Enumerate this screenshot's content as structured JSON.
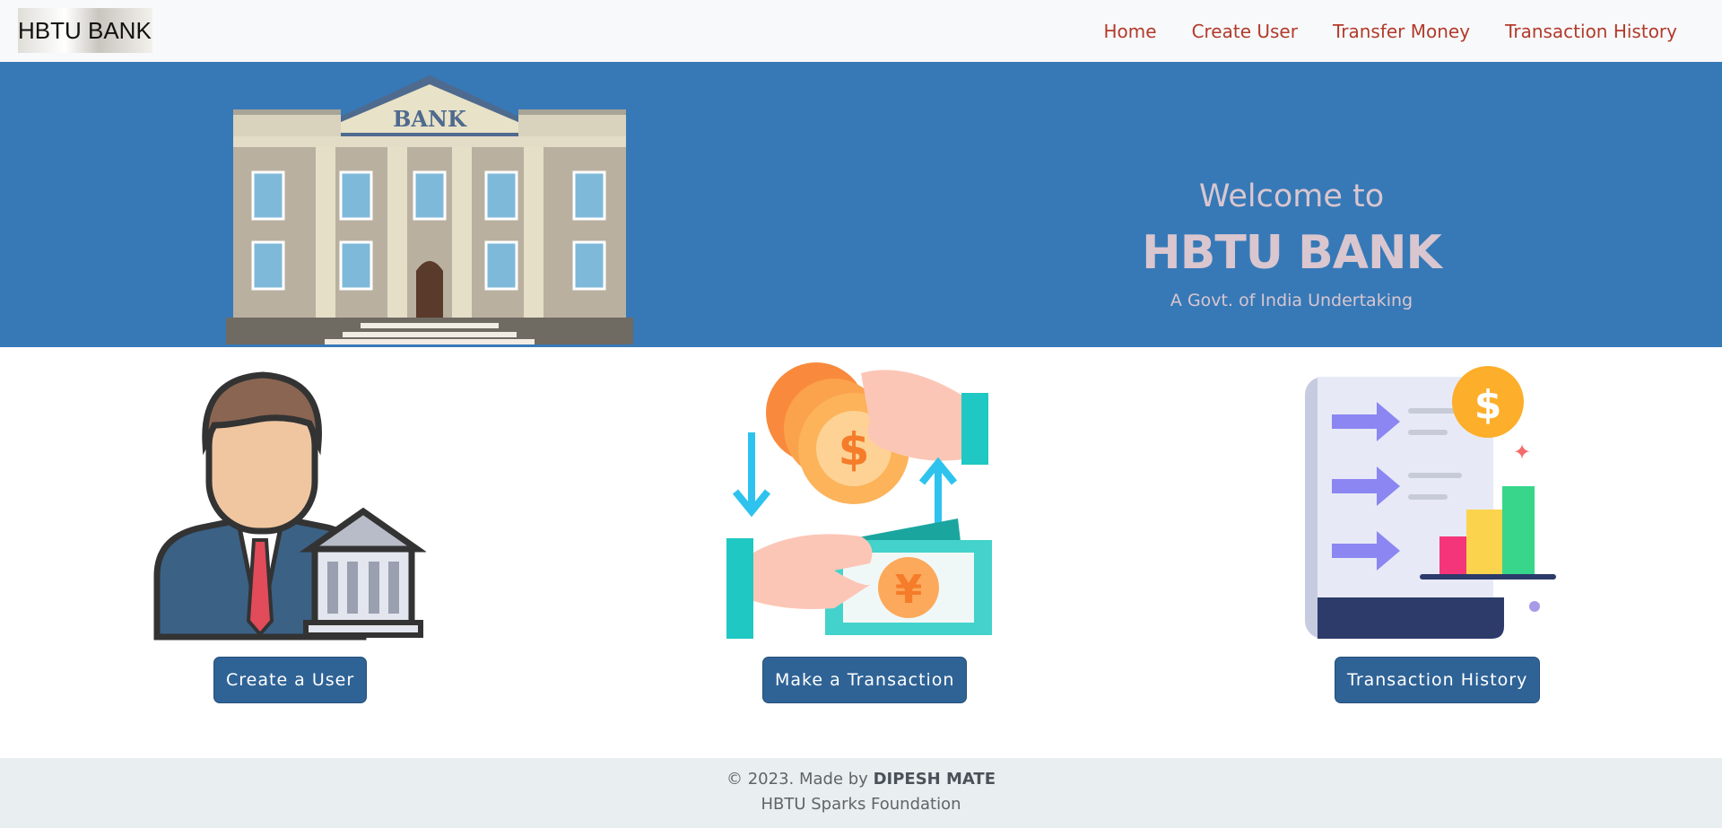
{
  "navbar": {
    "brand": "HBTU BANK",
    "links": [
      "Home",
      "Create User",
      "Transfer Money",
      "Transaction History"
    ]
  },
  "hero": {
    "welcome": "Welcome to",
    "bank_name": "HBTU BANK",
    "tagline": "A Govt. of India Undertaking",
    "illustration_label": "BANK"
  },
  "cards": [
    {
      "button_label": "Create a User",
      "icon": "user-bank-icon"
    },
    {
      "button_label": "Make a Transaction",
      "icon": "money-transfer-icon"
    },
    {
      "button_label": "Transaction History",
      "icon": "report-chart-icon"
    }
  ],
  "footer": {
    "copyright_prefix": "© 2023. Made by",
    "author": "DIPESH MATE",
    "org": "HBTU Sparks Foundation"
  },
  "colors": {
    "hero_bg": "#3779b7",
    "nav_link": "#b23a2b",
    "button_bg": "#2f6396",
    "footer_bg": "#e9eef1"
  }
}
